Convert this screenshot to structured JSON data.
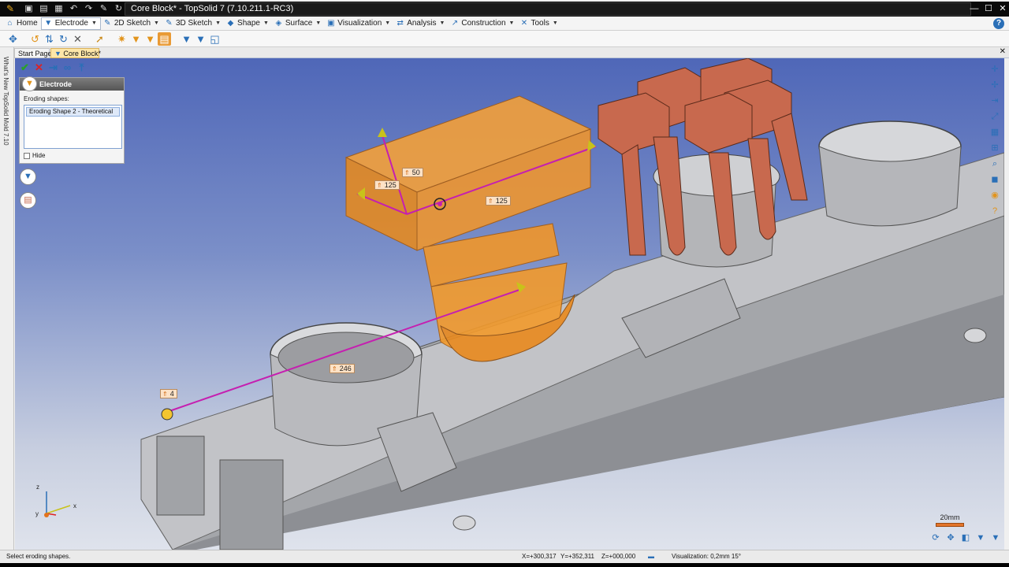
{
  "window": {
    "title": "Core Block* - TopSolid 7 (7.10.211.1-RC3)"
  },
  "ribbon": {
    "tabs": [
      {
        "label": "Home",
        "icon": "home-icon"
      },
      {
        "label": "Electrode",
        "icon": "electrode-icon"
      },
      {
        "label": "2D Sketch",
        "icon": "sketch-2d-icon"
      },
      {
        "label": "3D Sketch",
        "icon": "sketch-3d-icon"
      },
      {
        "label": "Shape",
        "icon": "shape-icon"
      },
      {
        "label": "Surface",
        "icon": "surface-icon"
      },
      {
        "label": "Visualization",
        "icon": "visualization-icon"
      },
      {
        "label": "Analysis",
        "icon": "analysis-icon"
      },
      {
        "label": "Construction",
        "icon": "construction-icon"
      },
      {
        "label": "Tools",
        "icon": "tools-icon"
      }
    ],
    "active_tab": "Electrode"
  },
  "document_tabs": {
    "start": "Start Page",
    "current": "Core Block*"
  },
  "side_strip_text": "What's New TopSolid Mold 7.10",
  "electrode_panel": {
    "title": "Electrode",
    "eroding_label": "Eroding shapes:",
    "items": [
      "Eroding Shape 2 - Theoretical"
    ],
    "hide_label": "Hide"
  },
  "dimensions": {
    "d50": "50",
    "d125_left": "125",
    "d125_right": "125",
    "d246": "246",
    "d4": "4"
  },
  "scale_label": "20mm",
  "triad": {
    "x": "x",
    "y": "y",
    "z": "z"
  },
  "status": {
    "message": "Select eroding shapes.",
    "x": "X=+300,317",
    "y": "Y=+352,311",
    "z": "Z=+000,000",
    "visualization": "Visualization: 0,2mm 15°"
  },
  "colors": {
    "viewport_top": "#4f67b8",
    "electrode_orange": "#f09a2a",
    "copper": "#c9694f",
    "part_gray": "#a9aaad",
    "axis_magenta": "#c51fb0"
  }
}
